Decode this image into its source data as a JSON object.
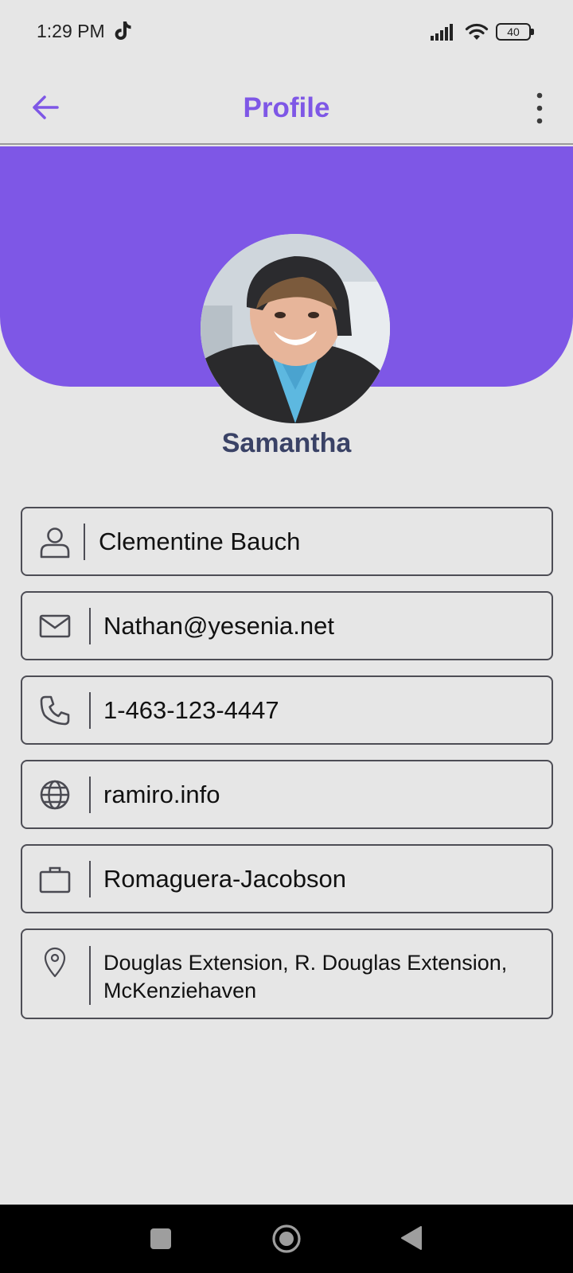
{
  "status_bar": {
    "time": "1:29 PM",
    "battery": "40",
    "icons": [
      "tiktok-icon",
      "signal-icon",
      "wifi-icon",
      "battery-icon"
    ]
  },
  "app_bar": {
    "title": "Profile",
    "back_icon": "arrow-left-icon",
    "menu_icon": "more-vertical-icon"
  },
  "colors": {
    "accent": "#7e57e6",
    "name_color": "#3a4266",
    "background": "#e6e6e6",
    "card_border": "#4d4d55"
  },
  "profile": {
    "display_name": "Samantha",
    "fields": [
      {
        "icon": "user-icon",
        "value": "Clementine Bauch"
      },
      {
        "icon": "mail-icon",
        "value": "Nathan@yesenia.net"
      },
      {
        "icon": "phone-icon",
        "value": "1-463-123-4447"
      },
      {
        "icon": "globe-icon",
        "value": "ramiro.info"
      },
      {
        "icon": "briefcase-icon",
        "value": "Romaguera-Jacobson"
      },
      {
        "icon": "location-pin-icon",
        "value": "Douglas Extension, R. Douglas Extension, McKenziehaven"
      }
    ]
  },
  "nav_bar": {
    "icons": [
      "recents-square-icon",
      "home-circle-icon",
      "back-triangle-icon"
    ]
  }
}
